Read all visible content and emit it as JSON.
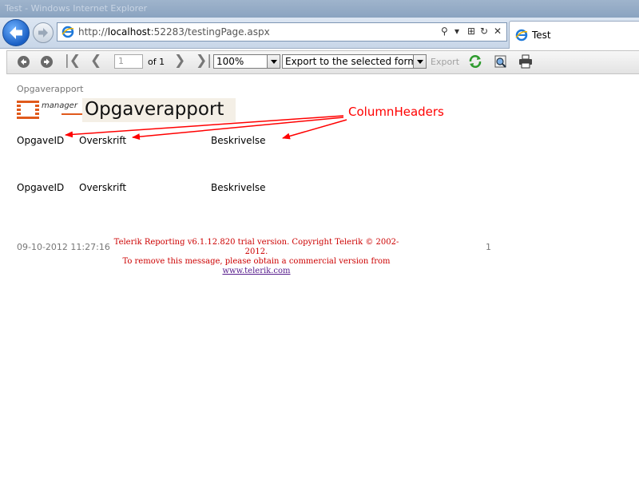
{
  "window": {
    "title": "Test - Windows Internet Explorer"
  },
  "browser": {
    "address_prefix": "http://",
    "address_host": "localhost",
    "address_rest": ":52283/testingPage.aspx",
    "tab_label": "Test",
    "ctl_search": "⚲",
    "ctl_dropdown": "▾",
    "ctl_compat": "⊞",
    "ctl_refresh": "↻",
    "ctl_stop": "✕"
  },
  "toolbar": {
    "page_input_value": "1",
    "of_label": "of 1",
    "first_glyph": "|❮",
    "prev_glyph": "❮",
    "next_glyph": "❯",
    "last_glyph": "❯|",
    "zoom_value": "100%",
    "export_format": "Export to the selected format",
    "export_label": "Export"
  },
  "report": {
    "small_title": "Opgaverapport",
    "logo_text": "manager",
    "main_title": "Opgaverapport",
    "column_headers": [
      "OpgaveID",
      "Overskrift",
      "Beskrivelse"
    ],
    "annotation": "ColumnHeaders",
    "footer_date": "09-10-2012 11:27:16",
    "trial_line1": "Telerik Reporting v6.1.12.820 trial version. Copyright Telerik © 2002-2012.",
    "trial_line2": "To remove this message, please obtain a commercial version from",
    "trial_link": "www.telerik.com",
    "page_number": "1"
  },
  "colors": {
    "annotation_red": "#ff0000",
    "trial_red": "#cc0000",
    "logo_orange": "#e05a1c"
  }
}
